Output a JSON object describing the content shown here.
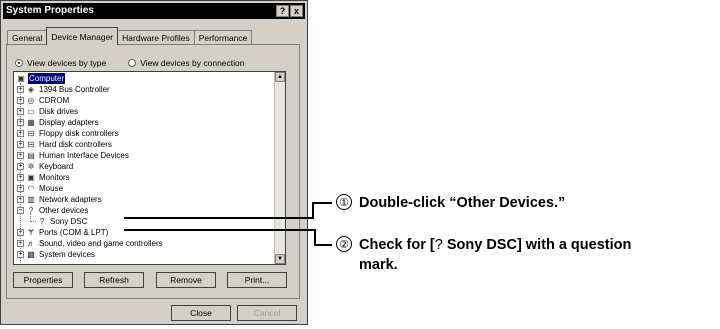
{
  "window": {
    "title": "System Properties",
    "help_button": "?",
    "close_button": "x"
  },
  "tabs": [
    {
      "label": "General"
    },
    {
      "label": "Device Manager"
    },
    {
      "label": "Hardware Profiles"
    },
    {
      "label": "Performance"
    }
  ],
  "view_options": {
    "by_type": "View devices by type",
    "by_connection": "View devices by connection",
    "selected": "by_type"
  },
  "tree": {
    "root": "Computer",
    "items": [
      {
        "label": "1394 Bus Controller",
        "icon": "bus-icon"
      },
      {
        "label": "CDROM",
        "icon": "cdrom-icon"
      },
      {
        "label": "Disk drives",
        "icon": "disk-icon"
      },
      {
        "label": "Display adapters",
        "icon": "display-icon"
      },
      {
        "label": "Floppy disk controllers",
        "icon": "floppy-icon"
      },
      {
        "label": "Hard disk controllers",
        "icon": "harddisk-icon"
      },
      {
        "label": "Human Interface Devices",
        "icon": "hid-icon"
      },
      {
        "label": "Keyboard",
        "icon": "keyboard-icon"
      },
      {
        "label": "Monitors",
        "icon": "monitor-icon"
      },
      {
        "label": "Mouse",
        "icon": "mouse-icon"
      },
      {
        "label": "Network adapters",
        "icon": "network-icon"
      },
      {
        "label": "Other devices",
        "icon": "question-icon",
        "expanded": true
      },
      {
        "label": "Sony DSC",
        "icon": "question-icon",
        "child": true
      },
      {
        "label": "Ports (COM & LPT)",
        "icon": "port-icon"
      },
      {
        "label": "Sound, video and game controllers",
        "icon": "sound-icon"
      },
      {
        "label": "System devices",
        "icon": "system-icon"
      }
    ]
  },
  "buttons": {
    "properties": "Properties",
    "refresh": "Refresh",
    "remove": "Remove",
    "print": "Print...",
    "close": "Close",
    "cancel": "Cancel"
  },
  "callouts": [
    {
      "number": "①",
      "text": "Double-click “Other Devices.”"
    },
    {
      "number": "②",
      "text_line1": "Check for [",
      "icon": "question-icon",
      "text_line1_end": " Sony DSC] with a question",
      "text_line2": "mark."
    }
  ]
}
